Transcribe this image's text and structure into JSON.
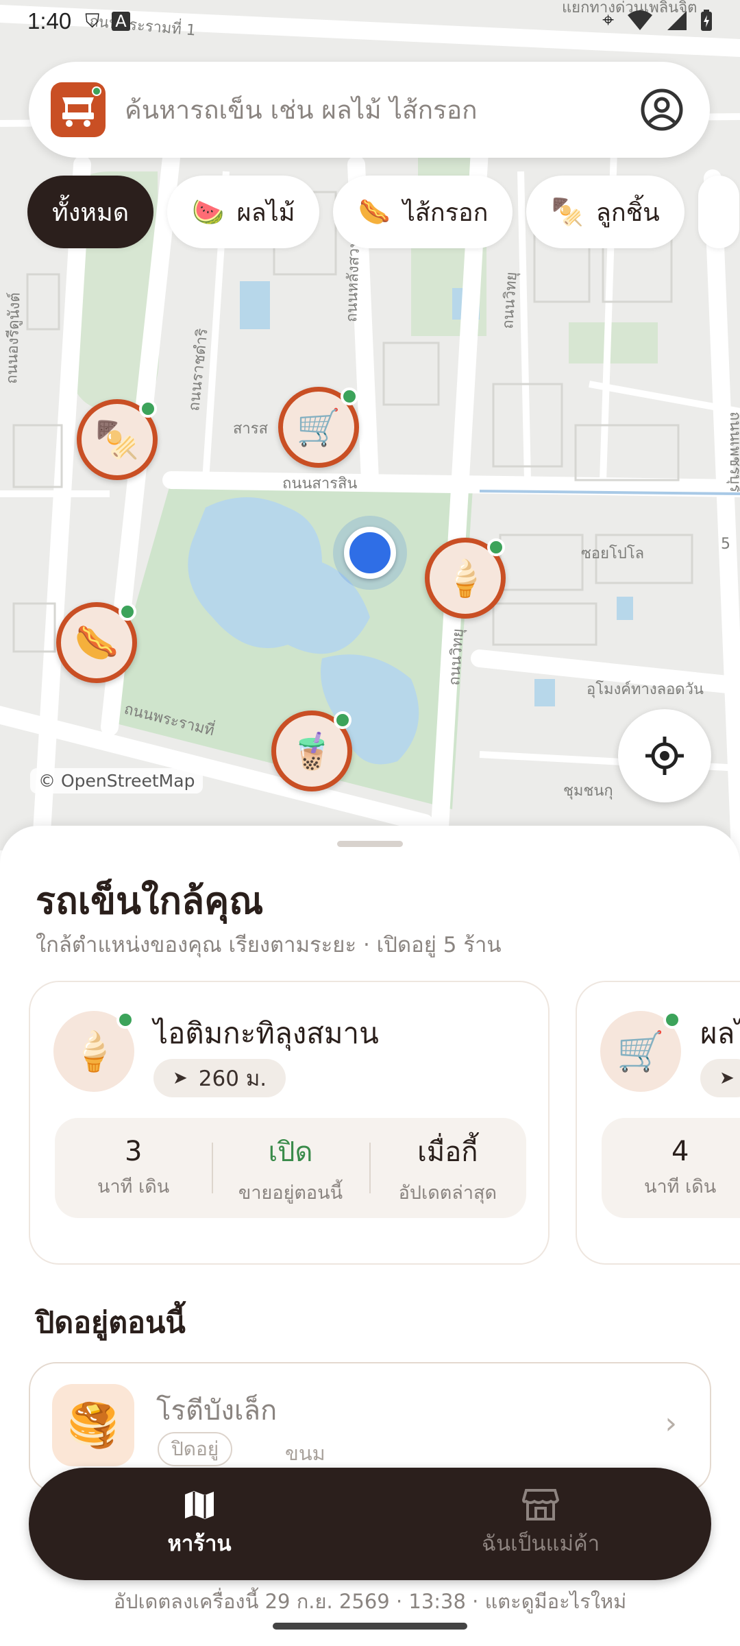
{
  "status": {
    "time": "1:40"
  },
  "search": {
    "placeholder": "ค้นหารถเข็น เช่น ผลไม้ ไส้กรอก"
  },
  "chips": [
    {
      "label": "ทั้งหมด",
      "icon": ""
    },
    {
      "label": "ผลไม้",
      "icon": "🍉"
    },
    {
      "label": "ไส้กรอก",
      "icon": "🌭"
    },
    {
      "label": "ลูกชิ้น",
      "icon": "🍢"
    }
  ],
  "map": {
    "attribution": "© OpenStreetMap",
    "labels": {
      "street_top": "ถนนพระรามที่ 1",
      "sarasin": "ถนนสารสิน",
      "sarasin_short": "สารส",
      "ratchadamri": "ถนนราชดำริ",
      "langsuan": "ถนนหลังสวน",
      "wittayu": "ถนนวิทยุ",
      "wittayu2": "ถนนวิทยุ",
      "rama4": "ถนนพระรามที่",
      "polo": "ซอยโปโล",
      "tunnel": "อุโมงค์ทางลอดวัน",
      "community": "ชุมชนกุ",
      "henri": "ถนนองรีดูนังต์",
      "phetkasem": "ถนนเพชรบุรี",
      "phloenchit": "แยกทางด่วนเพลินจิต",
      "num5": "5"
    }
  },
  "sheet": {
    "title": "รถเข็นใกล้คุณ",
    "subtitle": "ใกล้ตำแหน่งของคุณ เรียงตามระยะ · เปิดอยู่ 5 ร้าน",
    "cards": [
      {
        "name": "ไอติมกะทิลุงสมาน",
        "distance": "260 ม.",
        "stats": [
          {
            "value": "3",
            "label": "นาที เดิน"
          },
          {
            "value": "เปิด",
            "label": "ขายอยู่ตอนนี้"
          },
          {
            "value": "เมื่อกี้",
            "label": "อัปเดตล่าสุด"
          }
        ]
      },
      {
        "name": "ผลไม้",
        "stats": [
          {
            "value": "4",
            "label": "นาที เดิน"
          }
        ]
      }
    ],
    "closed_title": "ปิดอยู่ตอนนี้",
    "closed": {
      "name": "โรตีบังเล็ก",
      "badge": "ปิดอยู่",
      "category": "ขนม"
    }
  },
  "nav": {
    "find": "หาร้าน",
    "vendor": "ฉันเป็นแม่ค้า"
  },
  "footer": "อัปเดตลงเครื่องนี้ 29 ก.ย. 2569 · 13:38 · แตะดูมีอะไรใหม่",
  "colors": {
    "accent": "#c94f24",
    "dark": "#2b1f1c",
    "live": "#3ca35a",
    "me": "#2f6ee6"
  }
}
